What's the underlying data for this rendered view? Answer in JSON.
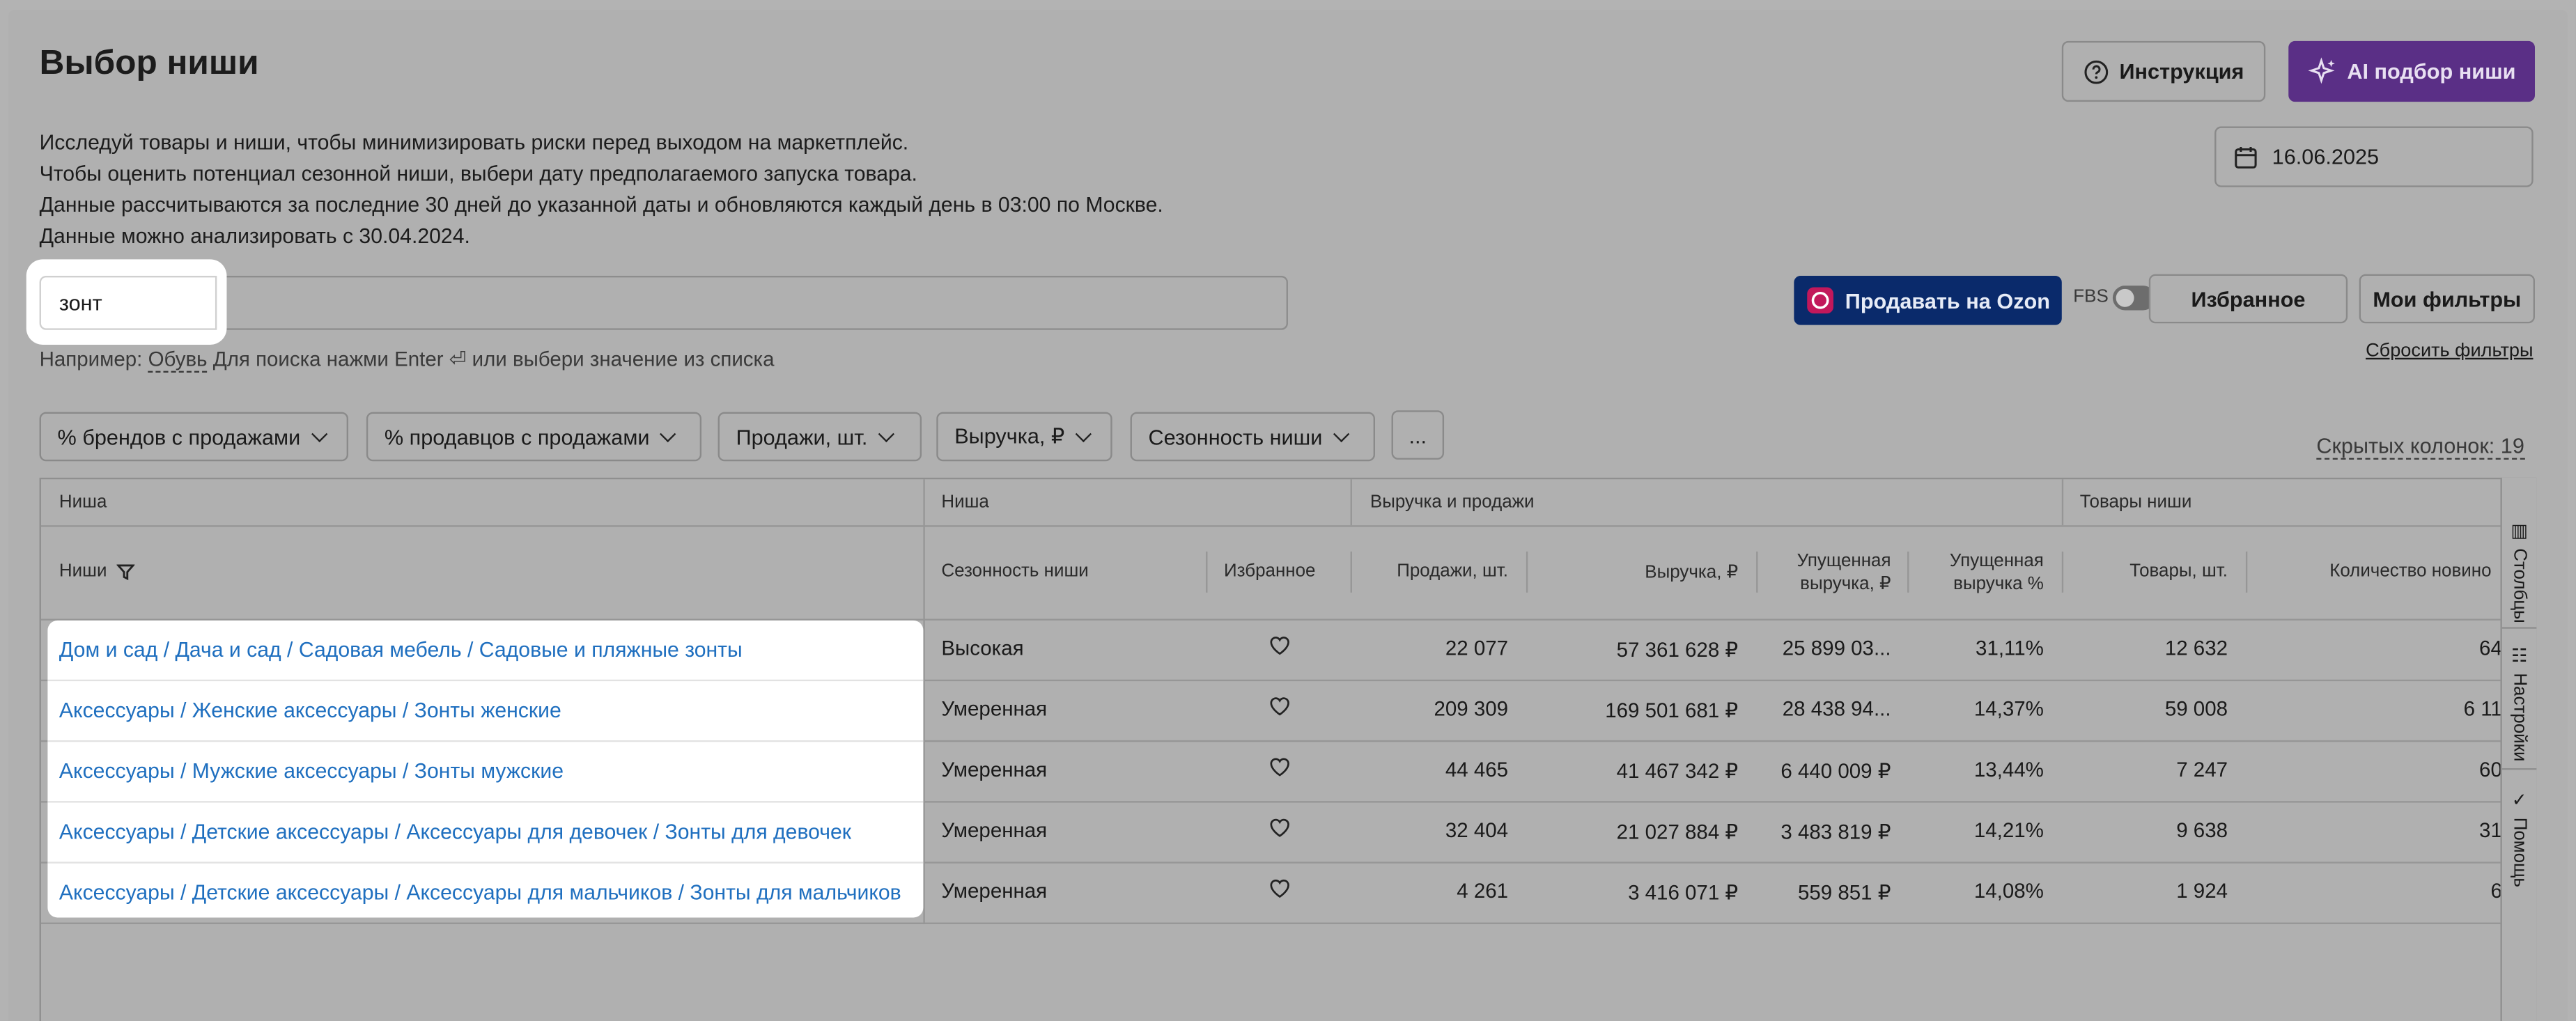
{
  "page": {
    "title": "Выбор ниши",
    "description": [
      "Исследуй товары и ниши, чтобы минимизировать риски перед выходом на маркетплейс.",
      "Чтобы оценить потенциал сезонной ниши, выбери дату предполагаемого запуска товара.",
      "Данные рассчитываются за последние 30 дней до указанной даты и обновляются каждый день в 03:00 по Москве.",
      "Данные можно анализировать с 30.04.2024."
    ]
  },
  "header_buttons": {
    "instruction": "Инструкция",
    "ai": "AI подбор ниши"
  },
  "date": {
    "value": "16.06.2025"
  },
  "search": {
    "value": "зонт",
    "hint_prefix": "Например:",
    "hint_example": "Обувь",
    "hint_suffix": "Для поиска нажми Enter ⏎ или выбери значение из списка"
  },
  "actions": {
    "sell_ozon": "Продавать на Ozon",
    "fbs_label": "FBS",
    "help_mark": "?",
    "favorites": "Избранное",
    "my_filters": "Мои фильтры",
    "reset_filters": "Сбросить фильтры"
  },
  "filters": {
    "chips": [
      "% брендов с продажами",
      "% продавцов с продажами",
      "Продажи, шт.",
      "Выручка, ₽",
      "Сезонность ниши"
    ],
    "more": "...",
    "hidden_columns": "Скрытых колонок: 19"
  },
  "table": {
    "groups": [
      "Ниша",
      "Ниша",
      "Выручка и продажи",
      "Товары ниши"
    ],
    "columns": {
      "niche": "Ниши",
      "season": "Сезонность ниши",
      "favorite": "Избранное",
      "sales": "Продажи, шт.",
      "revenue": "Выручка, ₽",
      "lost_revenue": [
        "Упущенная",
        "выручка, ₽"
      ],
      "lost_pct": [
        "Упущенная",
        "выручка %"
      ],
      "goods": "Товары, шт.",
      "new_count": "Количество новино"
    },
    "rows": [
      {
        "niche": "Дом и сад / Дача и сад / Садовая мебель / Садовые и пляжные зонты",
        "season": "Высокая",
        "sales": "22 077",
        "revenue": "57 361 628 ₽",
        "lost_revenue": "25 899 03...",
        "lost_pct": "31,11%",
        "goods": "12 632",
        "new_count": "64"
      },
      {
        "niche": "Аксессуары / Женские аксессуары / Зонты женские",
        "season": "Умеренная",
        "sales": "209 309",
        "revenue": "169 501 681 ₽",
        "lost_revenue": "28 438 94...",
        "lost_pct": "14,37%",
        "goods": "59 008",
        "new_count": "6 11"
      },
      {
        "niche": "Аксессуары / Мужские аксессуары / Зонты мужские",
        "season": "Умеренная",
        "sales": "44 465",
        "revenue": "41 467 342 ₽",
        "lost_revenue": "6 440 009 ₽",
        "lost_pct": "13,44%",
        "goods": "7 247",
        "new_count": "60"
      },
      {
        "niche": "Аксессуары / Детские аксессуары / Аксессуары для девочек / Зонты для девочек",
        "season": "Умеренная",
        "sales": "32 404",
        "revenue": "21 027 884 ₽",
        "lost_revenue": "3 483 819 ₽",
        "lost_pct": "14,21%",
        "goods": "9 638",
        "new_count": "31"
      },
      {
        "niche": "Аксессуары / Детские аксессуары / Аксессуары для мальчиков / Зонты для мальчиков",
        "season": "Умеренная",
        "sales": "4 261",
        "revenue": "3 416 071 ₽",
        "lost_revenue": "559 851 ₽",
        "lost_pct": "14,08%",
        "goods": "1 924",
        "new_count": "6"
      }
    ]
  },
  "side_tabs": [
    "Столбцы",
    "Настройки",
    "Помощь"
  ],
  "colors": {
    "overlay": "#b0b0b0",
    "ai_button": "#5a2f86",
    "ozon_button": "#0a2a6b",
    "link": "#1f6fbf"
  }
}
